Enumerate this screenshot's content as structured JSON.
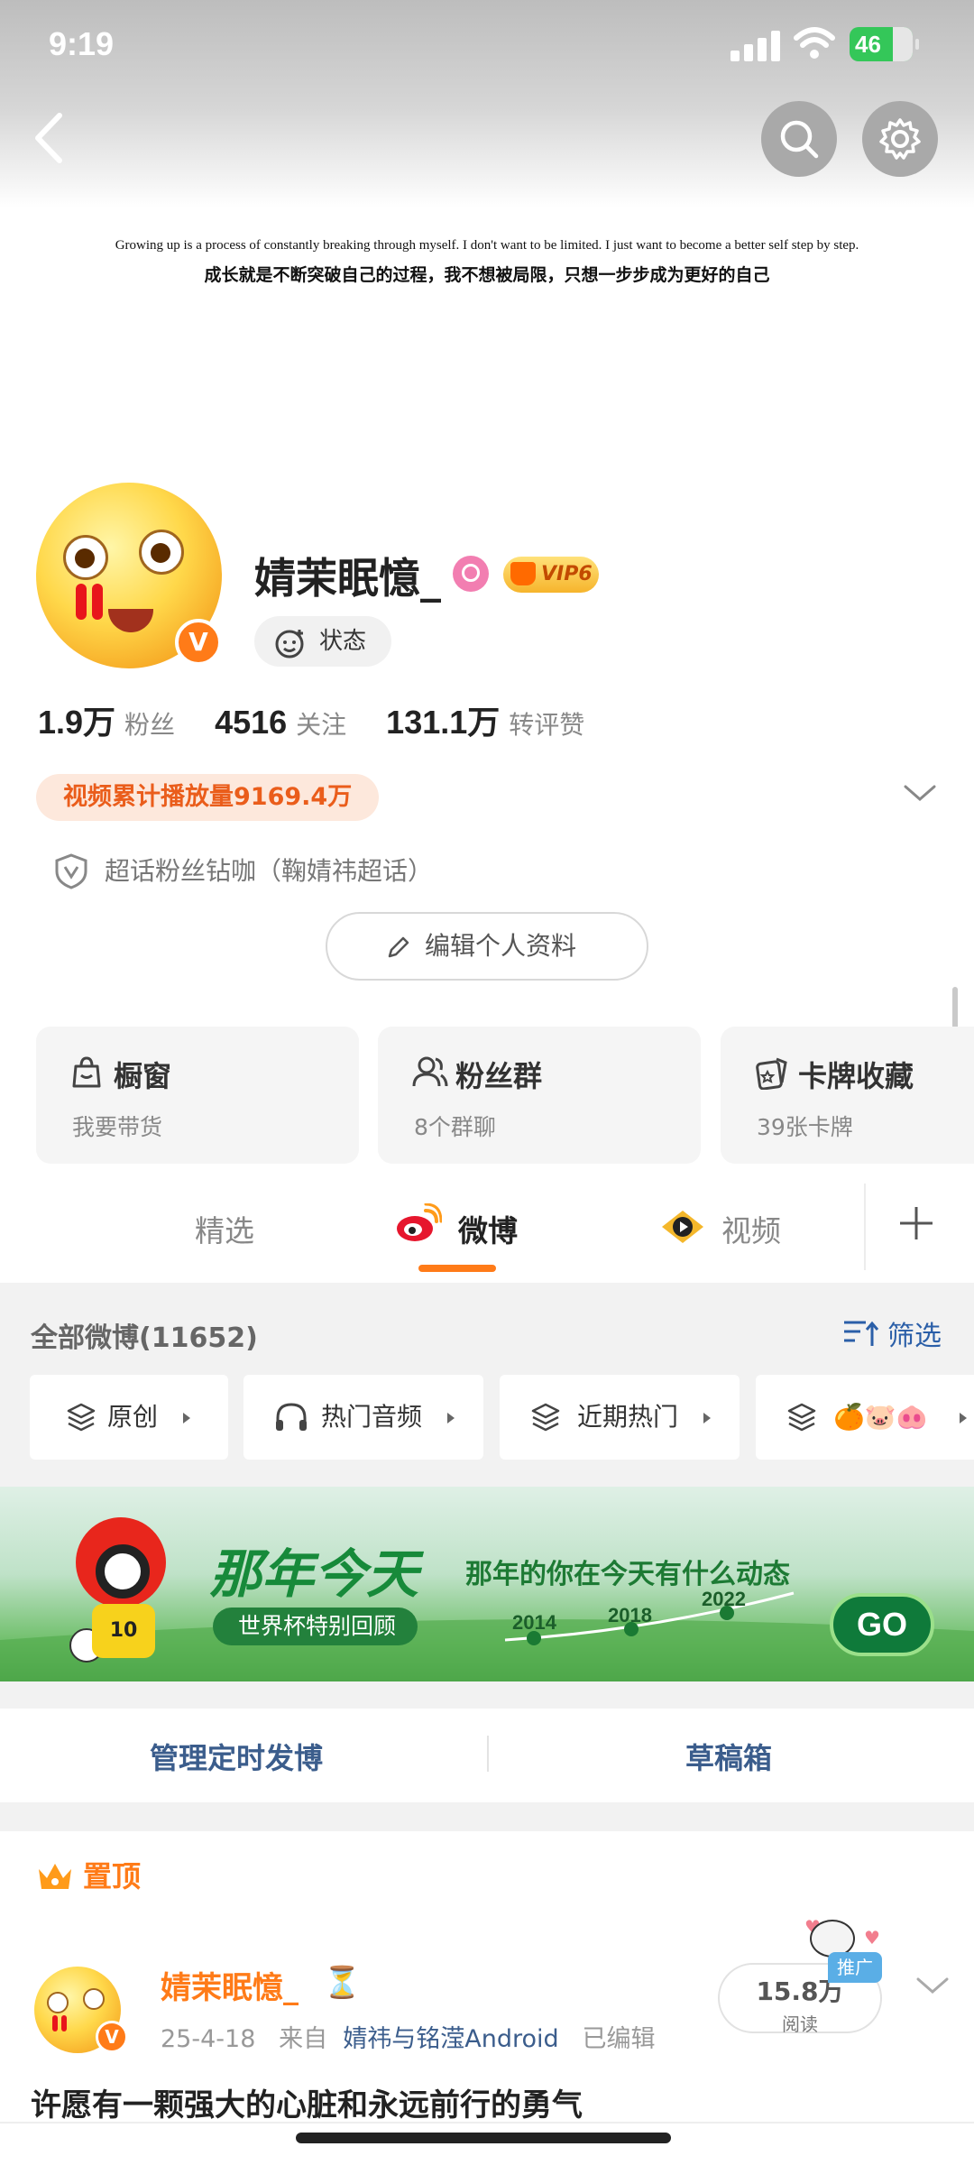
{
  "status_bar": {
    "time": "9:19",
    "battery": "46"
  },
  "cover": {
    "quote_en": "Growing up is a process of constantly breaking through myself. I don't want to be limited. I just want to become a better self step by step.",
    "quote_zh": "成长就是不断突破自己的过程，我不想被局限，只想一步步成为更好的自己"
  },
  "profile": {
    "name": "婧茉眠憶_",
    "vip_label": "VIP6",
    "verified_badge": "V",
    "status_label": "状态",
    "stats": [
      {
        "value": "1.9万",
        "label": "粉丝"
      },
      {
        "value": "4516",
        "label": "关注"
      },
      {
        "value": "131.1万",
        "label": "转评赞"
      }
    ],
    "video_plays": "视频累计播放量9169.4万",
    "super_topic": "超话粉丝钻咖（鞠婧祎超话）",
    "edit_button": "编辑个人资料"
  },
  "cards": [
    {
      "title": "橱窗",
      "sub": "我要带货",
      "icon": "shop-bag-icon"
    },
    {
      "title": "粉丝群",
      "sub": "8个群聊",
      "icon": "group-icon"
    },
    {
      "title": "卡牌收藏",
      "sub": "39张卡牌",
      "icon": "card-icon"
    }
  ],
  "tabs": [
    {
      "label": "精选"
    },
    {
      "label": "微博"
    },
    {
      "label": "视频"
    }
  ],
  "feed": {
    "all_label": "全部微博(11652)",
    "filter_label": "筛选",
    "chips": [
      {
        "label": "原创"
      },
      {
        "label": "热门音频"
      },
      {
        "label": "近期热门"
      },
      {
        "label": "🍊🐷🐽"
      }
    ]
  },
  "banner": {
    "title": "那年今天",
    "subtitle": "那年的你在今天有什么动态",
    "pill": "世界杯特别回顾",
    "years": [
      "2014",
      "2018",
      "2022"
    ],
    "go": "GO",
    "jersey": "10"
  },
  "actions": {
    "schedule": "管理定时发博",
    "drafts": "草稿箱"
  },
  "pinned_label": "置顶",
  "post": {
    "author": "婧茉眠憶_",
    "badge": "⏳",
    "date": "25-4-18",
    "from_label": "来自",
    "source": "婧祎与铭滢Android",
    "edited": "已编辑",
    "reads_value": "15.8万",
    "reads_label": "阅读",
    "promo": "推广",
    "text": "许愿有一颗强大的心脏和永远前行的勇气"
  },
  "colors": {
    "accent": "#ff7b18",
    "link": "#3b5d8c",
    "pill_bg": "#fde8dc"
  }
}
